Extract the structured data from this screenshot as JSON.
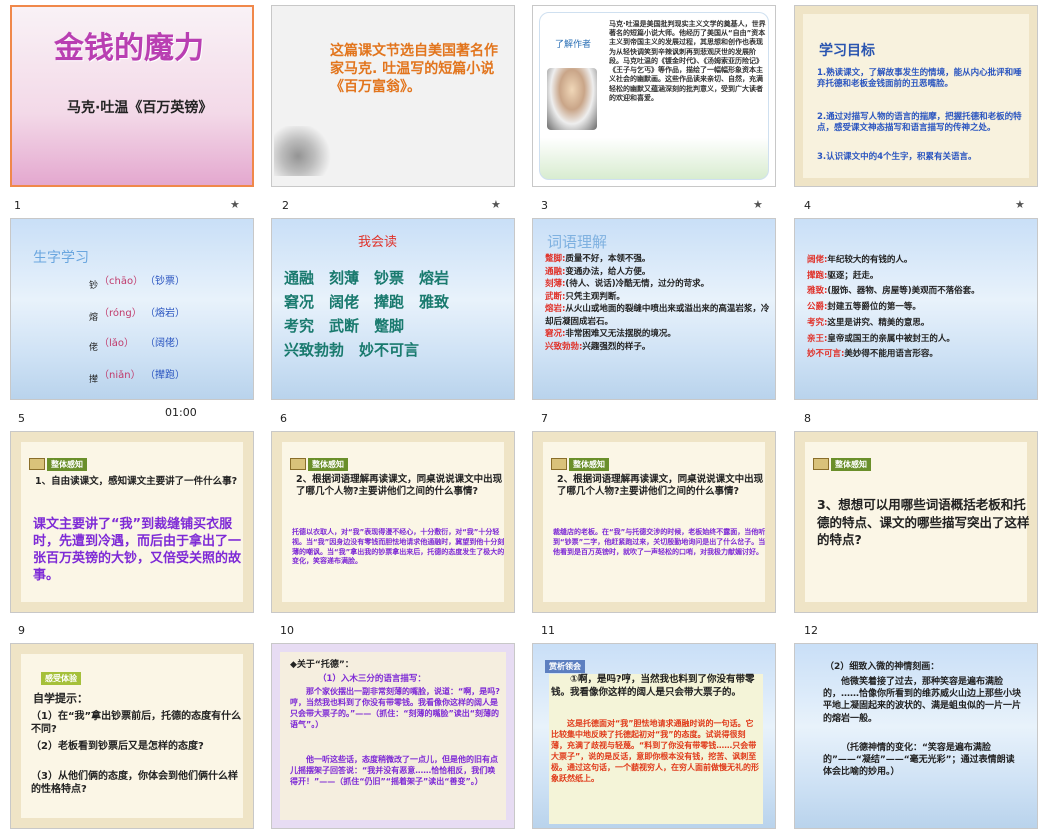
{
  "slides": [
    {
      "num": "1",
      "title": "金钱的魔力",
      "subtitle": "马克·吐温《百万英镑》"
    },
    {
      "num": "2",
      "text": "这篇课文节选自美国著名作家马克. 吐温写的短篇小说《百万富翁》。"
    },
    {
      "num": "3",
      "label": "了解作者",
      "text": "马克·吐温是美国批判现实主义文学的奠基人，世界著名的短篇小说大师。他经历了美国从“自由”资本主义到帝国主义的发展过程，其思想和创作也表现为从轻快调笑到辛辣讽刺再到悲观厌世的发展阶段。马克吐温的《镀金时代》、《汤姆索亚历险记》《王子与乞丐》等作品，描绘了一幅幅形象资本主义社会的幽默画。这些作品读来亲切、自然，充满轻松的幽默又蕴涵深刻的批判意义，受到广大读者的欢迎和喜爱。"
    },
    {
      "num": "4",
      "title": "学习目标",
      "items": [
        "1.熟读课文，了解故事发生的情境，能从内心批评和唾弃托德和老板金钱面前的丑恶嘴脸。",
        "2.通过对描写人物的语言的揣摩，把握托德和老板的特点，感受课文神态描写和语言描写的传神之处。",
        "3.认识课文中的4个生字，积累有关语言。"
      ]
    },
    {
      "num": "5",
      "title": "生字学习",
      "chars": [
        {
          "c": "钞",
          "py": "（chāo）",
          "w": "（钞票）"
        },
        {
          "c": "熔",
          "py": "（róng）",
          "w": "（熔岩）"
        },
        {
          "c": "佬",
          "py": "（lǎo）",
          "w": "（阔佬）"
        },
        {
          "c": "撵",
          "py": "（niǎn）",
          "w": "（撵跑）"
        }
      ],
      "timer": "01:00"
    },
    {
      "num": "6",
      "title": "我会读",
      "rows": [
        "通融　刻薄　钞票　熔岩",
        "窘况　阔佬　撵跑　雅致",
        "考究　武断　蹩脚",
        "兴致勃勃　妙不可言"
      ]
    },
    {
      "num": "7",
      "title": "词语理解",
      "defs": [
        {
          "k": "蹩脚:",
          "v": "质量不好，本领不强。"
        },
        {
          "k": "通融:",
          "v": "变通办法，给人方便。"
        },
        {
          "k": "刻薄:",
          "v": "(待人、说话)冷酷无情，过分的苛求。"
        },
        {
          "k": "武断:",
          "v": "只凭主观判断。"
        },
        {
          "k": "熔岩:",
          "v": "从火山或地面的裂缝中喷出来或溢出来的高温岩浆，冷却后凝固成岩石。"
        },
        {
          "k": "窘况:",
          "v": "非常困难又无法摆脱的境况。"
        },
        {
          "k": "兴致勃勃:",
          "v": "兴趣强烈的样子。"
        }
      ]
    },
    {
      "num": "8",
      "defs": [
        {
          "k": "阔佬:",
          "v": "年纪较大的有钱的人。"
        },
        {
          "k": "撵跑:",
          "v": "驱逐；赶走。"
        },
        {
          "k": "雅致:",
          "v": "(服饰、器物、房屋等)美观而不落俗套。"
        },
        {
          "k": "公爵:",
          "v": "封建五等爵位的第一等。"
        },
        {
          "k": "考究:",
          "v": "这里是讲究、精美的意思。"
        },
        {
          "k": "亲王:",
          "v": "皇帝或国王的亲属中被封王的人。"
        },
        {
          "k": "妙不可言:",
          "v": "美妙得不能用语言形容。"
        }
      ]
    },
    {
      "num": "9",
      "tag": "整体感知",
      "q": "1、自由读课文，感知课文主要讲了一件什么事?",
      "a": "课文主要讲了“我”到裁缝铺买衣服时，先遭到冷遇，而后由于拿出了一张百万英镑的大钞，又倍受关照的故事。"
    },
    {
      "num": "10",
      "tag": "整体感知",
      "q": "2、根据词语理解再读课文，同桌说说课文中出现了哪几个人物?主要讲他们之间的什么事情?",
      "a": "托德以衣取人，对“我”表现得漫不经心，十分敷衍，对“我”十分轻视。当“我”因身边没有零钱而胆怯地请求他通融时，冀望到他十分刻薄的嘲讽。当“我”拿出我的钞票拿出来后，托德的态度发生了极大的变化，笑容递布满脸。"
    },
    {
      "num": "11",
      "tag": "整体感知",
      "q": "2、根据词语理解再读课文，同桌说说课文中出现了哪几个人物?主要讲他们之间的什么事情?",
      "a": "裁缝店的老板。在“我”与托德交涉的时候，老板始终不露面，当他听到“钞票”二字，他赶紧跑过来，关切殷勤地询问是出了什么岔子。当他看到是百万英镑时，就吹了一声轻松的口哨，对我极力献媚讨好。"
    },
    {
      "num": "12",
      "tag": "整体感知",
      "q": "3、想想可以用哪些词语概括老板和托德的特点、课文的哪些描写突出了这样的特点?"
    },
    {
      "num": "13",
      "tag": "感受体验",
      "title": "自学提示：",
      "items": [
        "（1）在“我”拿出钞票前后，托德的态度有什么不同?",
        "（2）老板看到钞票后又是怎样的态度?",
        "（3）从他们俩的态度，你体会到他们俩什么样的性格特点?"
      ]
    },
    {
      "num": "14",
      "head": "◆关于“托德”：",
      "p1": "（1）入木三分的语言描写：",
      "p2": "那个家伙摆出一副非常刻薄的嘴脸，说道：“啊，是吗? 哼，当然我也料到了你没有带零钱。我看像你这样的阔人是只会带大票子的。”——（抓住：“刻薄的嘴脸”读出“刻薄的语气”。）",
      "p3": "他一听这些话，态度稍微改了一点儿，但是他的旧有点儿摇摆架子回答说：“我并没有恶意……恰恰相反，我们唤得开！”——（抓住“仍旧”“摇着架子”读出“善变”。）"
    },
    {
      "num": "15",
      "tag": "赏析领会",
      "quote": "①啊，是吗?哼，当然我也料到了你没有带零钱。我看像你这样的阔人是只会带大票子的。",
      "analysis": "这是托德面对“我”胆怯地请求通融时说的一句话。它比较集中地反映了托德起初对“我”的态度。试说得很刻薄，充满了歧视与轻蔑。“料到了你没有带零钱……只会带大票子”，说的是反话，意即你根本没有钱，挖苦、讽刺至极。通过这句话，一个藐视穷人，在穷人面前做慢无礼的形象跃然纸上。"
    },
    {
      "num": "16",
      "p1": "（2）细致入微的神情刻画：",
      "p2": "他微笑着接了过去，那种笑容是遍布满脸的，……恰像你所看到的维苏威火山边上那些小块平地上凝固起来的波状的、满是蛆虫似的一片一片的熔岩一般。",
      "p3": "（托德神情的变化：“笑容是遍布满脸的”——“凝结”——“毫无光彩”；通过表情朗读体会比喻的妙用。）"
    }
  ],
  "star_icon": "★"
}
